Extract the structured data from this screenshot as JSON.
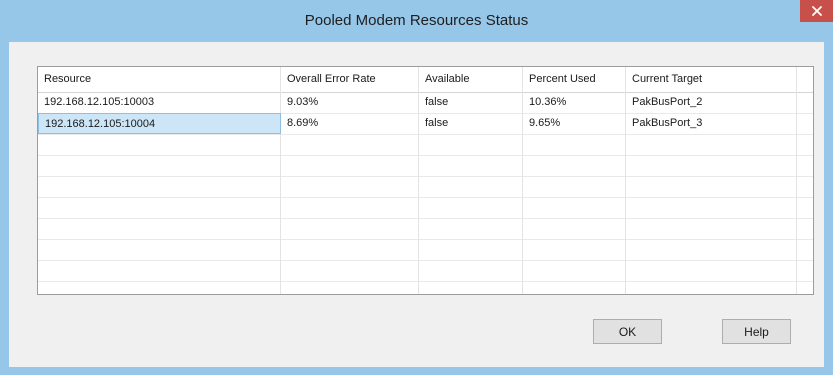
{
  "window": {
    "title": "Pooled Modem Resources Status",
    "close_icon": "close-icon"
  },
  "table": {
    "columns": [
      "Resource",
      "Overall Error Rate",
      "Available",
      "Percent Used",
      "Current Target"
    ],
    "rows": [
      [
        "192.168.12.105:10003",
        "9.03%",
        "false",
        "10.36%",
        "PakBusPort_2"
      ],
      [
        "192.168.12.105:10004",
        "8.69%",
        "false",
        "9.65%",
        "PakBusPort_3"
      ]
    ],
    "selected_row_index": 1,
    "selected_column_index": 0
  },
  "buttons": {
    "ok_label": "OK",
    "help_label": "Help"
  },
  "colors": {
    "titlebar": "#96c6e8",
    "close_button": "#c7504a",
    "dialog_background": "#f0f0f0",
    "selection": "#cde6f7"
  }
}
